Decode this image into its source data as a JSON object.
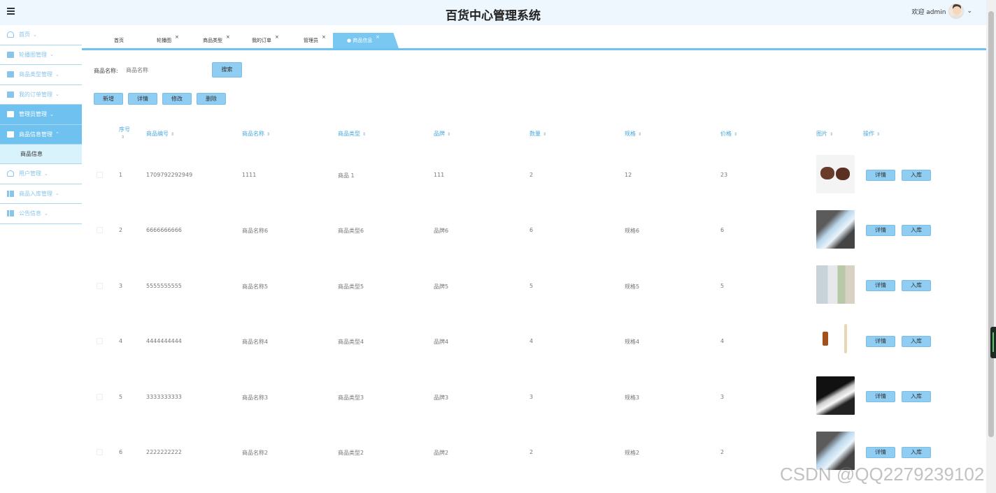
{
  "header": {
    "title": "百货中心管理系统",
    "welcome": "欢迎 admin",
    "caret": "⌄"
  },
  "sidebar": {
    "items": [
      {
        "label": "首页",
        "chev": "⌄"
      },
      {
        "label": "轮播图管理",
        "chev": "⌄"
      },
      {
        "label": "商品类型管理",
        "chev": "⌄"
      },
      {
        "label": "我的订单管理",
        "chev": "⌄"
      },
      {
        "label": "管理员管理",
        "chev": "⌄"
      },
      {
        "label": "商品信息管理",
        "chev": "⌃"
      },
      {
        "label": "用户管理",
        "chev": "⌄"
      },
      {
        "label": "商品入库管理",
        "chev": "⌄"
      },
      {
        "label": "公告信息",
        "chev": "⌄"
      }
    ],
    "sub_item": "商品信息"
  },
  "tabs": [
    {
      "label": "首页",
      "close": ""
    },
    {
      "label": "轮播图",
      "close": "×"
    },
    {
      "label": "商品类型",
      "close": "×"
    },
    {
      "label": "我的订单",
      "close": "×"
    },
    {
      "label": "管理员",
      "close": "×"
    },
    {
      "label": "● 商品信息",
      "close": "×"
    }
  ],
  "search": {
    "label": "商品名称:",
    "placeholder": "商品名称",
    "button": "搜索"
  },
  "actions": {
    "add": "新增",
    "detail": "详情",
    "edit": "修改",
    "delete": "删除"
  },
  "table": {
    "headers": [
      "序号",
      "商品编号",
      "商品名称",
      "商品类型",
      "品牌",
      "数量",
      "规格",
      "价格",
      "图片",
      "操作"
    ],
    "sort_glyph": "⇕",
    "row_buttons": {
      "detail": "详情",
      "stock_in": "入库"
    },
    "rows": [
      {
        "index": "1",
        "code": "1709792292949",
        "name": "1111",
        "type": "商品 1",
        "brand": "111",
        "qty": "2",
        "spec": "12",
        "price": "23"
      },
      {
        "index": "2",
        "code": "6666666666",
        "name": "商品名称6",
        "type": "商品类型6",
        "brand": "品牌6",
        "qty": "6",
        "spec": "规格6",
        "price": "6"
      },
      {
        "index": "3",
        "code": "5555555555",
        "name": "商品名称5",
        "type": "商品类型5",
        "brand": "品牌5",
        "qty": "5",
        "spec": "规格5",
        "price": "5"
      },
      {
        "index": "4",
        "code": "4444444444",
        "name": "商品名称4",
        "type": "商品类型4",
        "brand": "品牌4",
        "qty": "4",
        "spec": "规格4",
        "price": "4"
      },
      {
        "index": "5",
        "code": "3333333333",
        "name": "商品名称3",
        "type": "商品类型3",
        "brand": "品牌3",
        "qty": "3",
        "spec": "规格3",
        "price": "3"
      },
      {
        "index": "6",
        "code": "2222222222",
        "name": "商品名称2",
        "type": "商品类型2",
        "brand": "品牌2",
        "qty": "2",
        "spec": "规格2",
        "price": "2"
      }
    ]
  },
  "watermark": "CSDN @QQ2279239102",
  "colors": {
    "accent": "#6fc2ef",
    "button": "#8fcdf2",
    "header_bg": "#eef7fd",
    "submenu_bg": "#d9f3fd"
  }
}
